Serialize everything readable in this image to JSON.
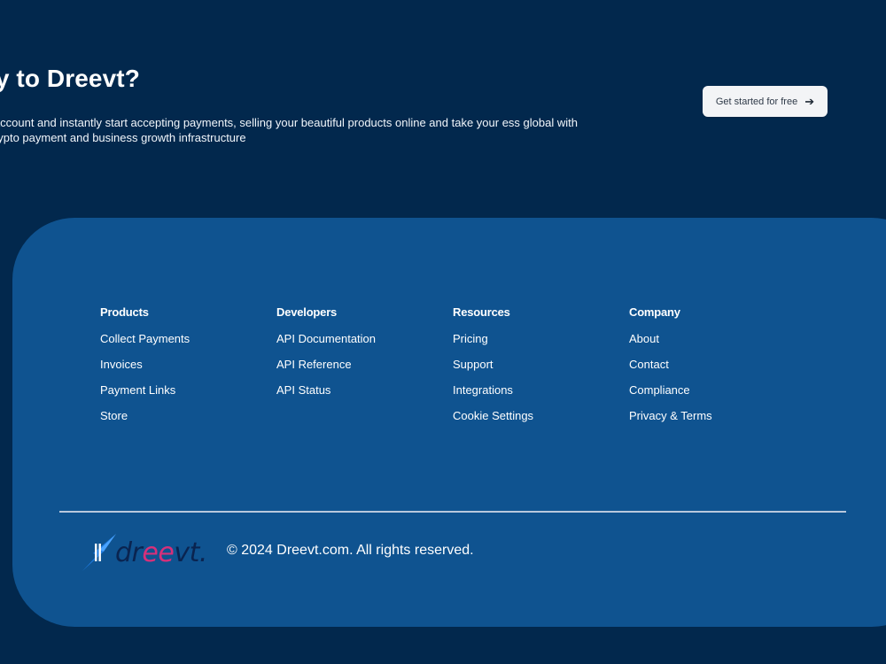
{
  "cta": {
    "title": "ady to Dreevt?",
    "description": "e an account and instantly start accepting payments, selling your beautiful products online and take your ess global with our crypto payment and business growth infrastructure",
    "button_label": "Get started for free",
    "button_icon": "arrow-right-icon"
  },
  "footer": {
    "columns": [
      {
        "heading": "Products",
        "links": [
          "Collect Payments",
          "Invoices",
          "Payment Links",
          "Store"
        ]
      },
      {
        "heading": "Developers",
        "links": [
          "API Documentation",
          "API Reference",
          "API Status"
        ]
      },
      {
        "heading": "Resources",
        "links": [
          "Pricing",
          "Support",
          "Integrations",
          "Cookie Settings"
        ]
      },
      {
        "heading": "Company",
        "links": [
          "About",
          "Contact",
          "Compliance",
          "Privacy & Terms"
        ]
      }
    ],
    "logo": {
      "part1": "dr",
      "part2": "ee",
      "part3": "vt."
    },
    "copyright": "© 2024 Dreevt.com. All rights reserved."
  },
  "colors": {
    "background": "#02284d",
    "footer_card": "#0f5390",
    "button_bg": "#f3f4f6",
    "logo_dark": "#0a2450",
    "logo_pink": "#d6307a",
    "logo_bolt": "#1e7be0"
  }
}
